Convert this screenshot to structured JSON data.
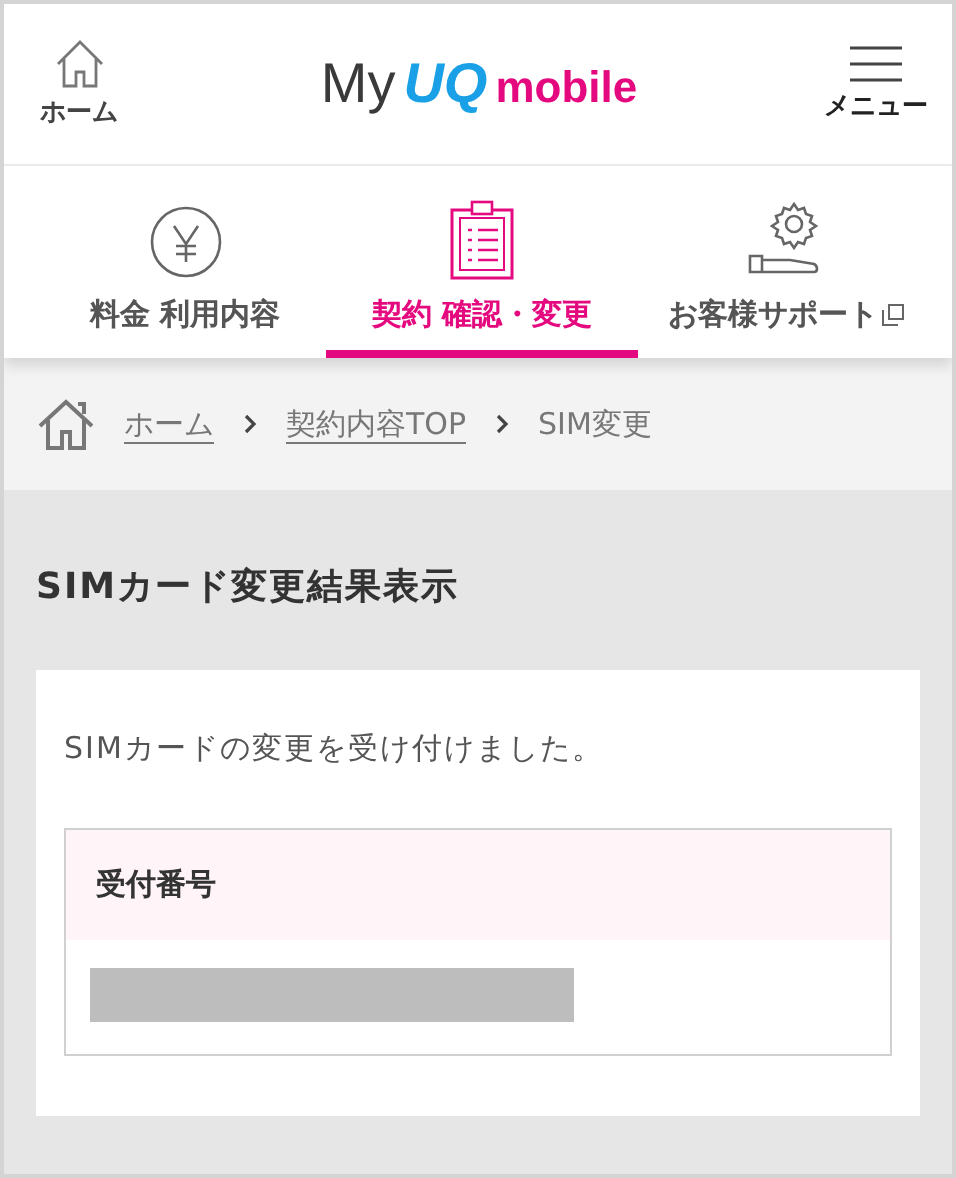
{
  "header": {
    "home_label": "ホーム",
    "menu_label": "メニュー",
    "logo": [
      {
        "text": "My",
        "kind": "plain"
      },
      {
        "text": "UQ",
        "kind": "brand"
      },
      {
        "text": "mobile",
        "kind": "accent"
      }
    ]
  },
  "nav_tabs": [
    {
      "label": "料金 利用内容",
      "kind": "yen",
      "selected": false,
      "external": false
    },
    {
      "label": "契約 確認・変更",
      "kind": "clipboard",
      "selected": true,
      "external": false
    },
    {
      "label": "お客様サポート",
      "kind": "support",
      "selected": false,
      "external": true
    }
  ],
  "breadcrumb": [
    {
      "label": "ホーム",
      "link": true
    },
    {
      "label": "契約内容TOP",
      "link": true
    },
    {
      "label": "SIM変更",
      "link": false
    }
  ],
  "page_title": "SIMカード変更結果表示",
  "message": "SIMカードの変更を受け付けました。",
  "receipt": {
    "label": "受付番号"
  }
}
